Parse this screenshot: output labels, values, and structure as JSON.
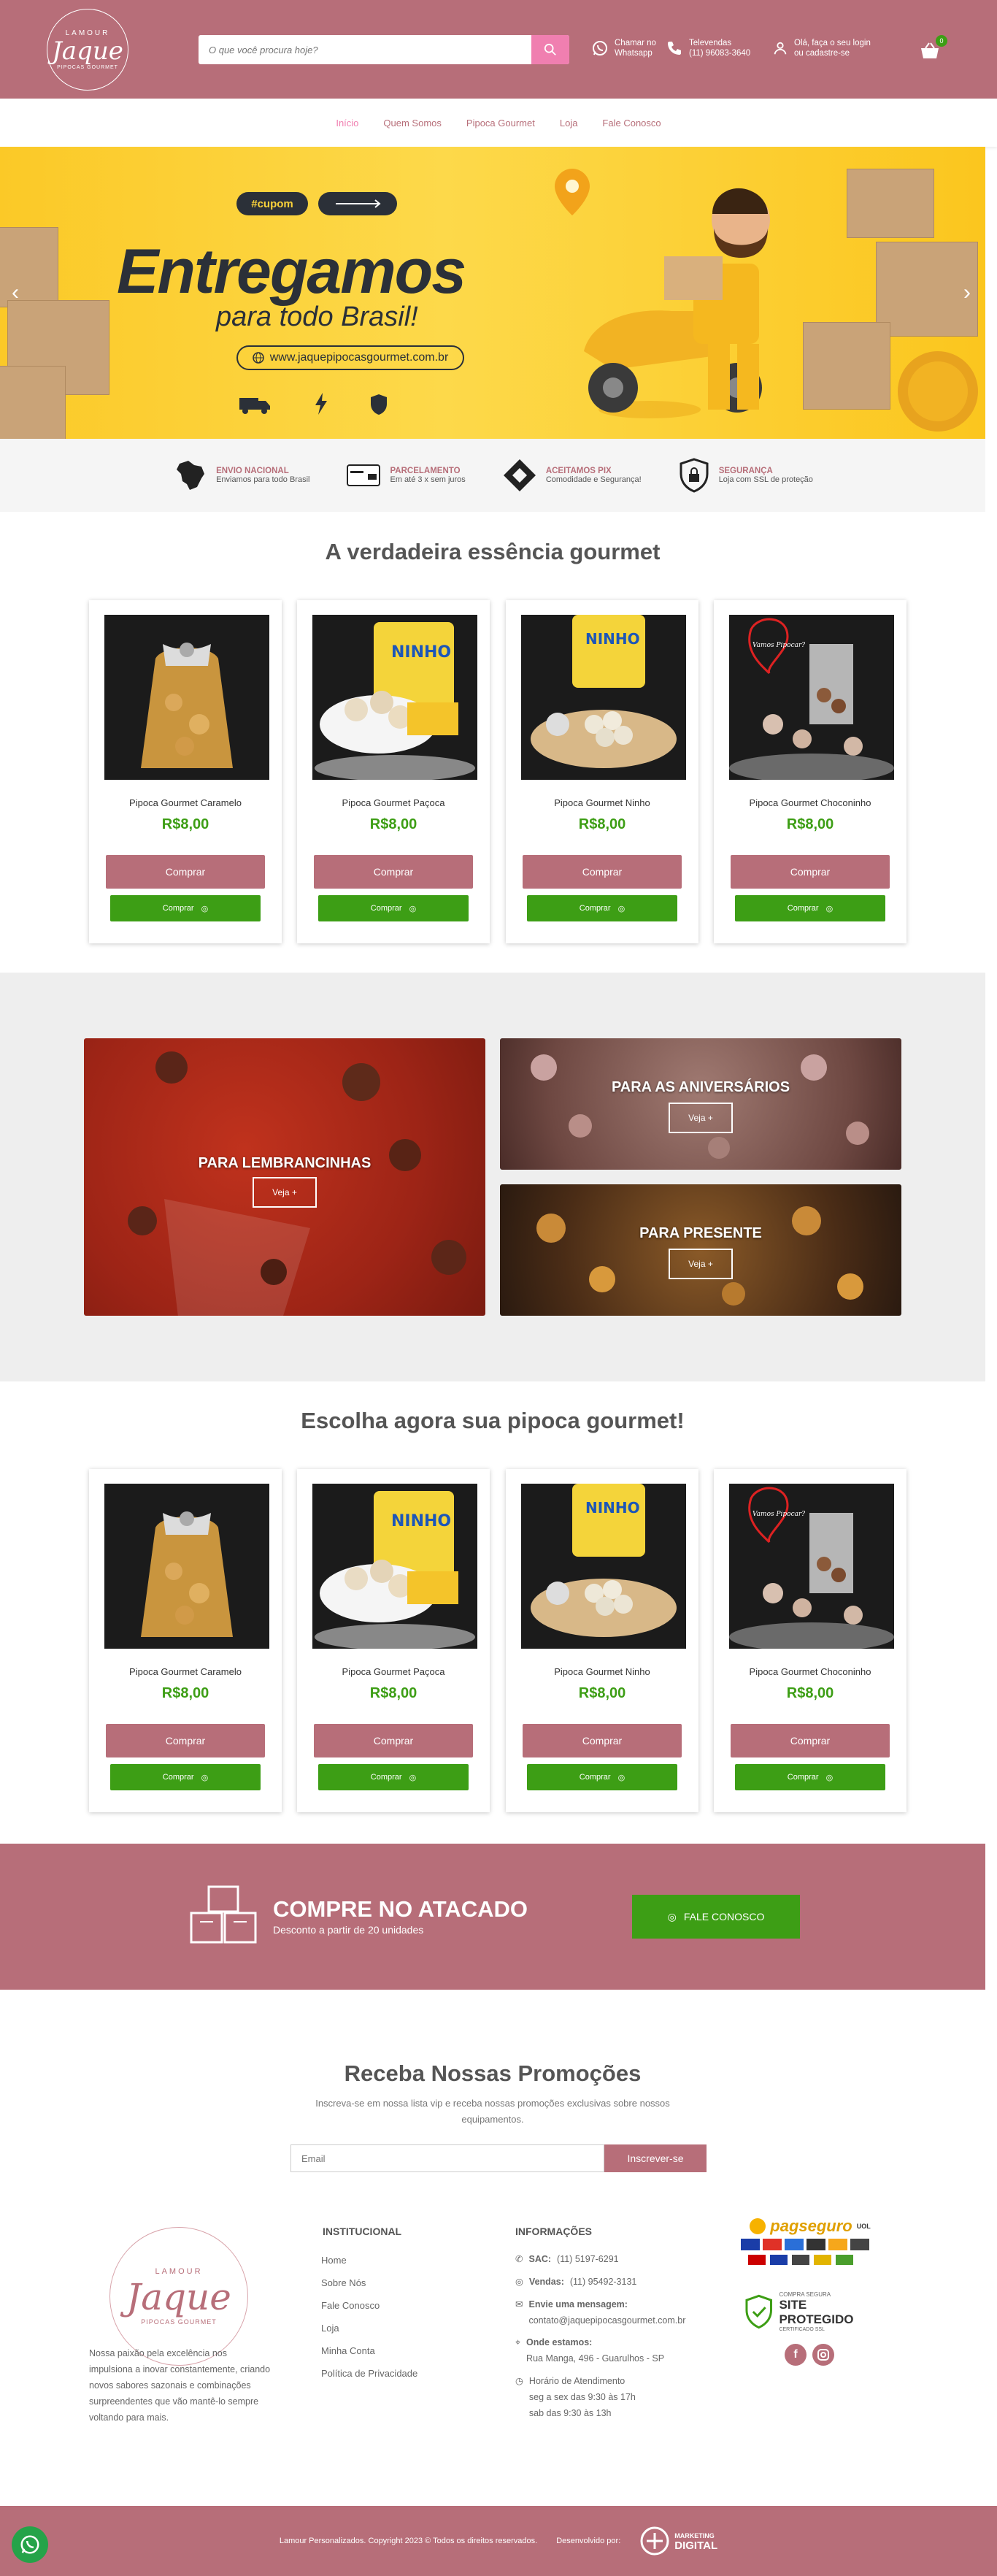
{
  "header": {
    "logo": {
      "top": "LAMOUR",
      "name": "Jaque",
      "bottom": "PIPOCAS GOURMET"
    },
    "search_placeholder": "O que você procura hoje?",
    "whatsapp": {
      "line1": "Chamar no",
      "line2": "Whatsapp"
    },
    "phone": {
      "line1": "Televendas",
      "line2": "(11) 96083-3640"
    },
    "login": {
      "line1": "Olá, faça o seu login",
      "line2": "ou cadastre-se"
    },
    "cart_count": "0"
  },
  "nav": [
    "Início",
    "Quem Somos",
    "Pipoca Gourmet",
    "Loja",
    "Fale Conosco"
  ],
  "hero": {
    "tag": "#cupom",
    "headline": "Entregamos",
    "subline": "para todo Brasil!",
    "url": "www.jaquepipocasgourmet.com.br"
  },
  "features": [
    {
      "title": "ENVIO NACIONAL",
      "sub": "Enviamos para todo Brasil",
      "icon": "brazil-map-icon"
    },
    {
      "title": "PARCELAMENTO",
      "sub": "Em até 3 x sem juros",
      "icon": "credit-card-icon"
    },
    {
      "title": "ACEITAMOS PIX",
      "sub": "Comodidade e Segurança!",
      "icon": "pix-icon"
    },
    {
      "title": "SEGURANÇA",
      "sub": "Loja com SSL de proteção",
      "icon": "shield-lock-icon"
    }
  ],
  "section1_title": "A verdadeira essência gourmet",
  "section2_title": "Escolha agora sua pipoca gourmet!",
  "products": [
    {
      "name": "Pipoca Gourmet Caramelo",
      "price": "R$8,00",
      "buy": "Comprar",
      "wa": "Comprar"
    },
    {
      "name": "Pipoca Gourmet Paçoca",
      "price": "R$8,00",
      "buy": "Comprar",
      "wa": "Comprar"
    },
    {
      "name": "Pipoca Gourmet Ninho",
      "price": "R$8,00",
      "buy": "Comprar",
      "wa": "Comprar"
    },
    {
      "name": "Pipoca Gourmet Choconinho",
      "price": "R$8,00",
      "buy": "Comprar",
      "wa": "Comprar"
    }
  ],
  "product_image_text": {
    "ninho": "NINHO",
    "card": "Vamos Pipocar?"
  },
  "categories": [
    {
      "title": "PARA LEMBRANCINHAS",
      "button": "Veja +"
    },
    {
      "title": "PARA AS ANIVERSÁRIOS",
      "button": "Veja +"
    },
    {
      "title": "PARA PRESENTE",
      "button": "Veja +"
    }
  ],
  "wholesale": {
    "title": "COMPRE NO ATACADO",
    "sub": "Desconto a partir de 20 unidades",
    "button": "FALE CONOSCO"
  },
  "newsletter": {
    "title": "Receba Nossas Promoções",
    "sub": "Inscreva-se em nossa lista vip e receba nossas promoções exclusivas sobre nossos equipamentos.",
    "placeholder": "Email",
    "button": "Inscrever-se"
  },
  "footer": {
    "about": "Nossa paixão pela excelência nos impulsiona a inovar constantemente, criando novos sabores sazonais e combinações surpreendentes que vão mantê-lo sempre voltando para mais.",
    "inst_title": "INSTITUCIONAL",
    "inst_links": [
      "Home",
      "Sobre Nós",
      "Fale Conosco",
      "Loja",
      "Minha Conta",
      "Política de Privacidade"
    ],
    "info_title": "INFORMAÇÕES",
    "sac_label": "SAC:",
    "sac": "(11) 5197-6291",
    "sales_label": "Vendas:",
    "sales": "(11) 95492-3131",
    "email_label": "Envie uma mensagem:",
    "email": "contato@jaquepipocasgourmet.com.br",
    "address_label": "Onde estamos:",
    "address": "Rua Manga, 496 - Guarulhos - SP",
    "hours_title": "Horário de Atendimento",
    "hours1": "seg a sex das 9:30 às 17h",
    "hours2": "sab das 9:30 às 13h",
    "pagseguro": {
      "brand": "pagseguro",
      "sub": "UOL"
    },
    "secure": {
      "line1": "COMPRA SEGURA",
      "line2": "SITE PROTEGIDO",
      "line3": "CERTIFICADO SSL"
    }
  },
  "bottom": {
    "copyright": "Lamour Personalizados. Copyright 2023 © Todos os direitos reservados.",
    "dev": "Desenvolvido por:",
    "brand1": "MARKETING",
    "brand2": "DIGITAL"
  },
  "colors": {
    "brand": "#b76e79",
    "green": "#3d9e15",
    "pink": "#f07fb0",
    "yellow": "#fbc927"
  }
}
